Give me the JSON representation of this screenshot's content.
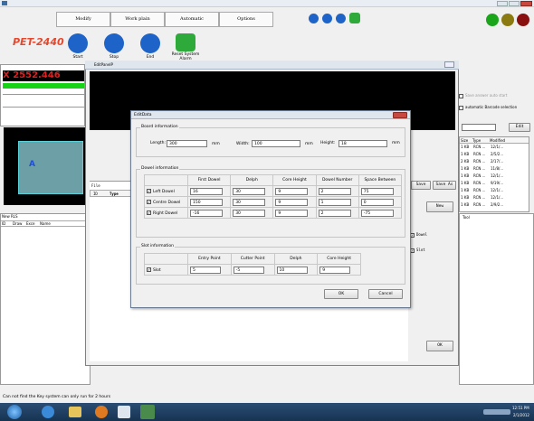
{
  "menu": {
    "tabs": [
      "Modify",
      "Work plain",
      "Automatic",
      "Options"
    ]
  },
  "app": {
    "name": "PET-2440"
  },
  "toolbar": {
    "start": "Start",
    "stop": "Stop",
    "end": "End",
    "reset": "Reset System Alarm"
  },
  "counter": {
    "value": "X 2552.446"
  },
  "preview": {
    "label": "A"
  },
  "left": {
    "list_title": "New RLS",
    "cols": [
      "ID",
      "Draw",
      "Exce",
      "Name"
    ]
  },
  "mid": {
    "file_label": "File",
    "cols": [
      "ID",
      "Type"
    ]
  },
  "window": {
    "title": "EditPanelP"
  },
  "right": {
    "chk1": "Save answer auto start",
    "chk2": "automatic Barcode selection",
    "edit": "Edit",
    "cols": [
      "Size",
      "Type",
      "Modified"
    ],
    "files": [
      [
        "1 KB",
        "RCN ...",
        "12/1/..."
      ],
      [
        "1 KB",
        "RCN ...",
        "2/5/2..."
      ],
      [
        "2 KB",
        "RCN ...",
        "2/17/..."
      ],
      [
        "1 KB",
        "RCN ...",
        "11/8/..."
      ],
      [
        "1 KB",
        "RCN ...",
        "12/1/..."
      ],
      [
        "1 KB",
        "RCN ...",
        "9/19/..."
      ],
      [
        "1 KB",
        "RCN ...",
        "12/1/..."
      ],
      [
        "1 KB",
        "RCN ...",
        "12/1/..."
      ],
      [
        "1 KB",
        "RCN ...",
        "2/9/2..."
      ]
    ],
    "save": "Save",
    "saveas": "Save As",
    "new": "New",
    "dowel": "Dowel",
    "slot": "Slot",
    "ok": "OK",
    "tool": "Tool"
  },
  "dialog": {
    "title": "EditData",
    "board": {
      "title": "Board information",
      "length_label": "Length:",
      "length": "300",
      "width_label": "Width:",
      "width": "100",
      "height_label": "Height:",
      "height": "18",
      "unit": "mm"
    },
    "dowel": {
      "title": "Dowel information",
      "headers": [
        "First Dowel",
        "Delph",
        "Core Height",
        "Dowel Number",
        "Space Between"
      ],
      "rows": [
        {
          "label": "Left Dowel",
          "vals": [
            "16",
            "30",
            "9",
            "2",
            "75"
          ]
        },
        {
          "label": "Centre Dowel",
          "vals": [
            "150",
            "30",
            "9",
            "1",
            "0"
          ]
        },
        {
          "label": "Right Dowel",
          "vals": [
            "-16",
            "30",
            "9",
            "2",
            "-75"
          ]
        }
      ]
    },
    "slot": {
      "title": "Slot information",
      "headers": [
        "Entry Point",
        "Cutter Point",
        "Delph",
        "Core Height"
      ],
      "row": {
        "label": "Slot",
        "vals": [
          "5",
          "-5",
          "10",
          "9"
        ]
      }
    },
    "ok": "OK",
    "cancel": "Cancel"
  },
  "status": {
    "text": "Can not find the Key system can only run for 2 hours"
  },
  "clock": {
    "time": "12:51 PM",
    "date": "2/1/2012"
  }
}
